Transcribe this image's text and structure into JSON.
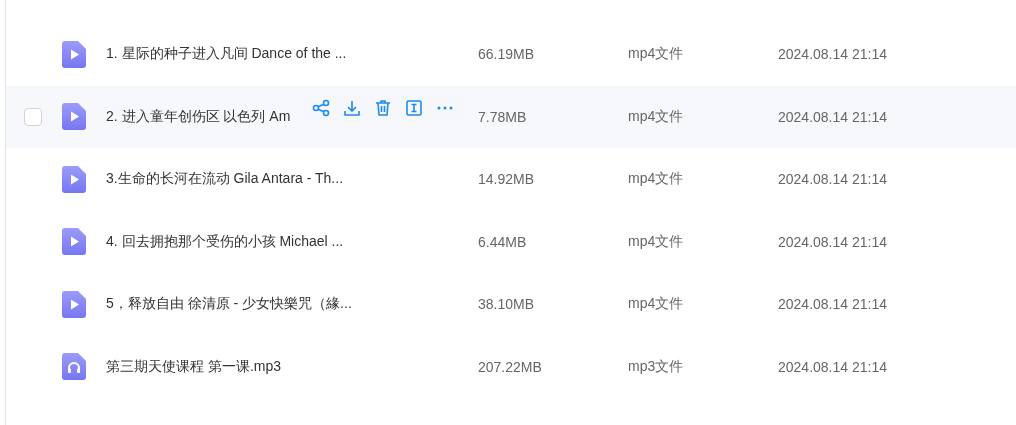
{
  "files": [
    {
      "kind": "video",
      "name": "1. 星际的种子进入凡间 Dance of the ...",
      "size": "66.19MB",
      "type": "mp4文件",
      "modified": "2024.08.14 21:14",
      "hovered": false,
      "checked": false
    },
    {
      "kind": "video",
      "name": "2. 进入童年创伤区 以色列 Am",
      "size": "7.78MB",
      "type": "mp4文件",
      "modified": "2024.08.14 21:14",
      "hovered": true,
      "checked": false
    },
    {
      "kind": "video",
      "name": "3.生命的长河在流动 Gila Antara - Th...",
      "size": "14.92MB",
      "type": "mp4文件",
      "modified": "2024.08.14 21:14",
      "hovered": false,
      "checked": false
    },
    {
      "kind": "video",
      "name": "4. 回去拥抱那个受伤的小孩 Michael ...",
      "size": "6.44MB",
      "type": "mp4文件",
      "modified": "2024.08.14 21:14",
      "hovered": false,
      "checked": false
    },
    {
      "kind": "video",
      "name": "5，释放自由 徐清原 - 少女快樂咒（緣...",
      "size": "38.10MB",
      "type": "mp4文件",
      "modified": "2024.08.14 21:14",
      "hovered": false,
      "checked": false
    },
    {
      "kind": "audio",
      "name": "第三期天使课程 第一课.mp3",
      "size": "207.22MB",
      "type": "mp3文件",
      "modified": "2024.08.14 21:14",
      "hovered": false,
      "checked": false
    }
  ]
}
